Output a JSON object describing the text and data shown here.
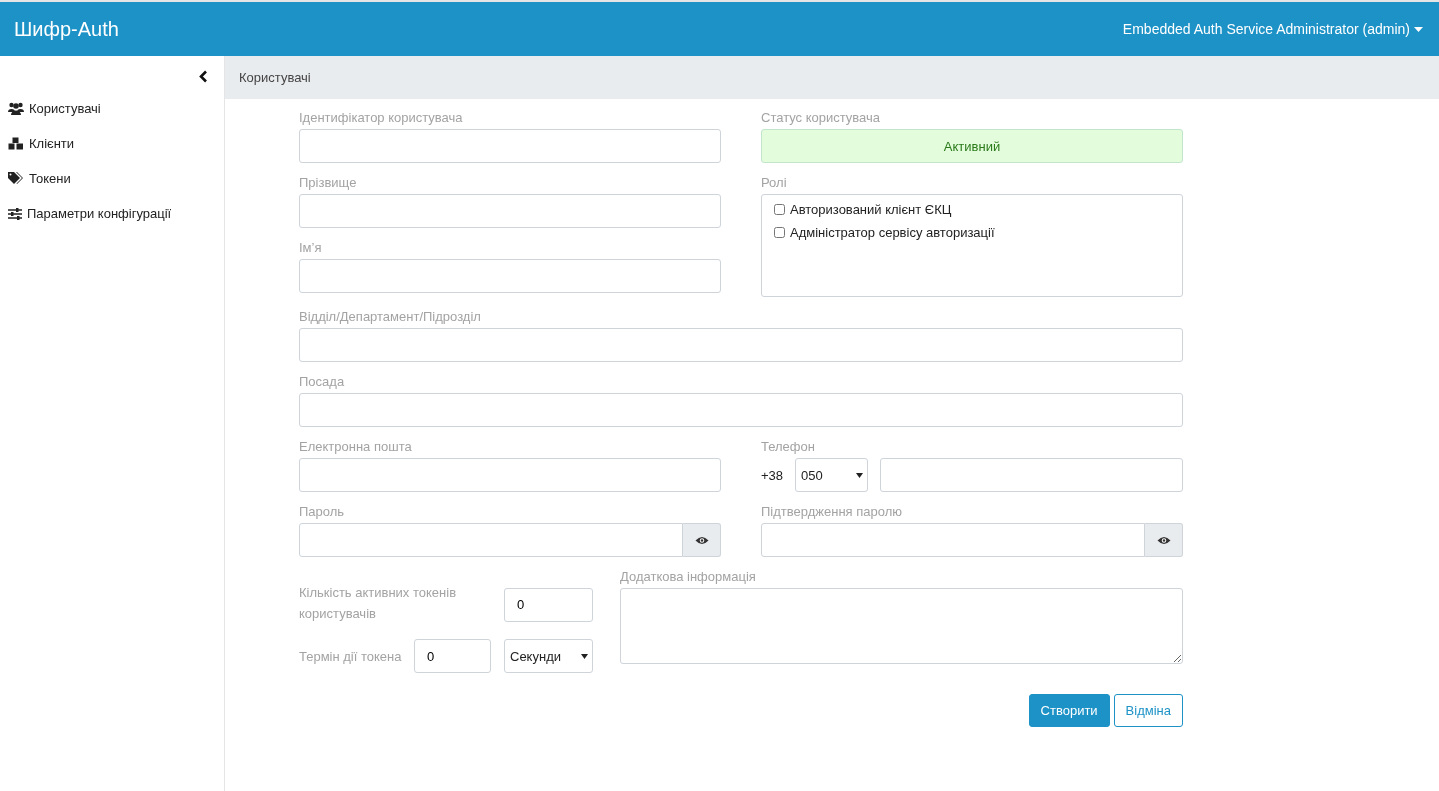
{
  "header": {
    "brand": "Шифр-Auth",
    "user_menu": "Embedded Auth Service Administrator (admin)"
  },
  "sidebar": {
    "items": [
      {
        "label": "Користувачі"
      },
      {
        "label": "Клієнти"
      },
      {
        "label": "Токени"
      },
      {
        "label": "Параметри конфігурації"
      }
    ]
  },
  "breadcrumb": "Користувачі",
  "form": {
    "user_id": {
      "label": "Ідентифікатор користувача"
    },
    "status": {
      "label": "Статус користувача",
      "value": "Активний"
    },
    "surname": {
      "label": "Прізвище"
    },
    "first_name": {
      "label": "Ім’я"
    },
    "roles": {
      "label": "Ролі",
      "items": [
        {
          "label": "Авторизований клієнт ЄКЦ",
          "checked": false
        },
        {
          "label": "Адміністратор сервісу авторизації",
          "checked": false
        }
      ]
    },
    "department": {
      "label": "Відділ/Департамент/Підрозділ"
    },
    "position": {
      "label": "Посада"
    },
    "email": {
      "label": "Електронна пошта"
    },
    "phone": {
      "label": "Телефон",
      "prefix": "+38",
      "code": "050"
    },
    "password": {
      "label": "Пароль"
    },
    "password_confirm": {
      "label": "Підтвердження паролю"
    },
    "token_count": {
      "label": "Кількість активних токенів користувачів",
      "value": "0"
    },
    "token_lifetime": {
      "label": "Термін дії токена",
      "value": "0",
      "unit": "Секунди"
    },
    "notes": {
      "label": "Додаткова інформація"
    }
  },
  "buttons": [
    {
      "label": "Створити",
      "kind": "primary"
    },
    {
      "label": "Відміна",
      "kind": "outline"
    }
  ]
}
